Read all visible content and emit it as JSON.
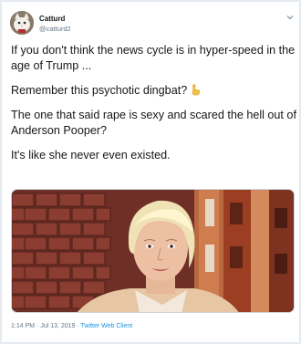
{
  "user": {
    "name": "Catturd",
    "handle": "@catturd2"
  },
  "tweet": {
    "paragraphs": [
      "If you don't think the news cycle is in hyper-speed in the age of Trump ...",
      "Remember this psychotic dingbat?",
      "The one that said rape is sexy and scared the hell out of Anderson Pooper?",
      "It's like she never even existed."
    ],
    "emoji": "pointing-down-hand",
    "media_icon": "news-clip-photo"
  },
  "meta": {
    "time": "1:14 PM",
    "separator": " · ",
    "date": "Jul 13, 2019",
    "client": "Twitter Web Client"
  },
  "colors": {
    "link": "#1b95e0",
    "secondary_text": "#657786",
    "primary_text": "#14171a"
  }
}
